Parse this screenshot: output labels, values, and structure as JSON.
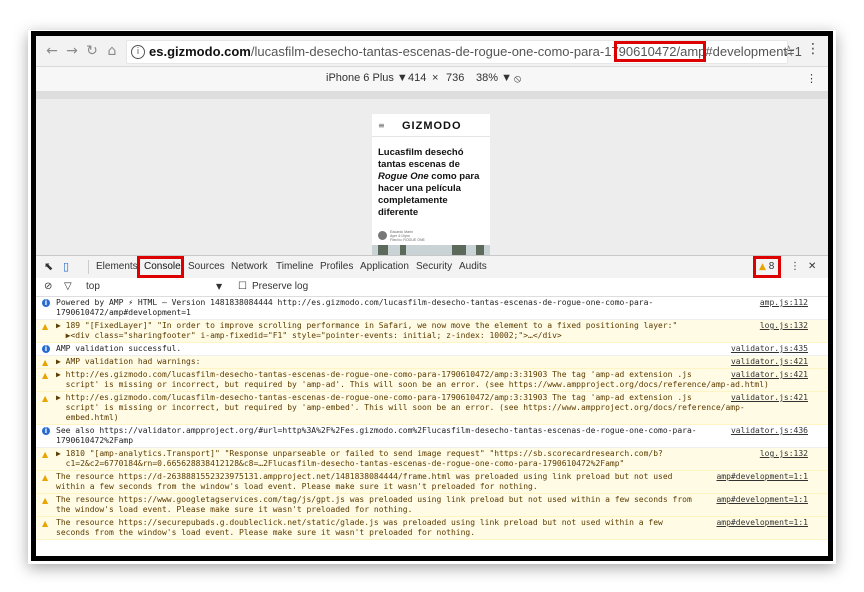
{
  "browser": {
    "url_host": "es.gizmodo.com",
    "url_path": "/lucasfilm-desecho-tantas-escenas-de-rogue-one-como-para-1790610472/amp",
    "url_hash": "#development=1"
  },
  "device_toolbar": {
    "device": "iPhone 6 Plus ▼",
    "width": "414",
    "times": "×",
    "height": "736",
    "zoom": "38% ▼"
  },
  "page": {
    "logo": "GIZMODO",
    "headline_1": "Lucasfilm desechó tantas escenas de ",
    "headline_italic_1": "Rogue One",
    "headline_2": " como para hacer una película completamente diferente",
    "byline_name": "Eduardo Marín",
    "byline_role": "Ayer 4:10pm",
    "byline_extra": "Filed to: ROGUE ONE"
  },
  "devtools": {
    "tabs": [
      "Elements",
      "Console",
      "Sources",
      "Network",
      "Timeline",
      "Profiles",
      "Application",
      "Security",
      "Audits"
    ],
    "warning_count": "8",
    "filter_value": "top",
    "preserve_log": "Preserve log"
  },
  "console": [
    {
      "level": "info",
      "lines": [
        "Powered by AMP ⚡ HTML – Version 1481838084444 http://es.gizmodo.com/lucasfilm-desecho-tantas-escenas-de-rogue-one-como-para-",
        "1790610472/amp#development=1"
      ],
      "src": "amp.js:112"
    },
    {
      "level": "warn",
      "lines": [
        "▶ 189 \"[FixedLayer]\" \"In order to improve scrolling performance in Safari, we now move the element to a fixed positioning layer:\"",
        "  ▶<div class=\"sharingfooter\" i-amp-fixedid=\"F1\" style=\"pointer-events: initial; z-index: 10002;\">…</div>"
      ],
      "src": "log.js:132"
    },
    {
      "level": "info",
      "lines": [
        "AMP validation successful."
      ],
      "src": "validator.js:435"
    },
    {
      "level": "warn",
      "lines": [
        "▶ AMP validation had warnings:"
      ],
      "src": "validator.js:421"
    },
    {
      "level": "warn",
      "lines": [
        "▶ http://es.gizmodo.com/lucasfilm-desecho-tantas-escenas-de-rogue-one-como-para-1790610472/amp:3:31903 The tag 'amp-ad extension .js",
        "  script' is missing or incorrect, but required by 'amp-ad'. This will soon be an error. (see https://www.ampproject.org/docs/reference/amp-ad.html)"
      ],
      "src": "validator.js:421"
    },
    {
      "level": "warn",
      "lines": [
        "▶ http://es.gizmodo.com/lucasfilm-desecho-tantas-escenas-de-rogue-one-como-para-1790610472/amp:3:31903 The tag 'amp-ad extension .js",
        "  script' is missing or incorrect, but required by 'amp-embed'. This will soon be an error. (see https://www.ampproject.org/docs/reference/amp-",
        "  embed.html)"
      ],
      "src": "validator.js:421"
    },
    {
      "level": "info",
      "lines": [
        "See also https://validator.ampproject.org/#url=http%3A%2F%2Fes.gizmodo.com%2Flucasfilm-desecho-tantas-escenas-de-rogue-one-como-para-",
        "1790610472%2Famp"
      ],
      "src": "validator.js:436"
    },
    {
      "level": "warn",
      "lines": [
        "▶ 1810 \"[amp-analytics.Transport]\" \"Response unparseable or failed to send image request\" \"https://sb.scorecardresearch.com/b?",
        "  c1=2&c2=6770184&rn=0.665628838412128&c8=…2Flucasfilm-desecho-tantas-escenas-de-rogue-one-como-para-1790610472%2Famp\""
      ],
      "src": "log.js:132"
    },
    {
      "level": "warn",
      "lines": [
        "The resource https://d-2638881552323975131.ampproject.net/1481838084444/frame.html was preloaded using link preload but not used",
        "within a few seconds from the window's load event. Please make sure it wasn't preloaded for nothing."
      ],
      "src": "amp#development=1:1"
    },
    {
      "level": "warn",
      "lines": [
        "The resource https://www.googletagservices.com/tag/js/gpt.js was preloaded using link preload but not used within a few seconds from",
        "the window's load event. Please make sure it wasn't preloaded for nothing."
      ],
      "src": "amp#development=1:1"
    },
    {
      "level": "warn",
      "lines": [
        "The resource https://securepubads.g.doubleclick.net/static/glade.js was preloaded using link preload but not used within a few",
        "seconds from the window's load event. Please make sure it wasn't preloaded for nothing."
      ],
      "src": "amp#development=1:1"
    }
  ]
}
